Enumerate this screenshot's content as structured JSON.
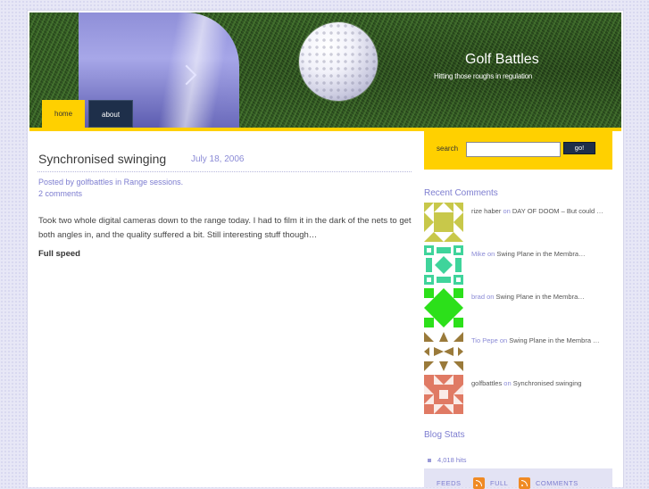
{
  "site": {
    "title": "Golf Battles",
    "tagline": "Hitting those roughs in regulation"
  },
  "nav": {
    "tabs": [
      {
        "label": "home",
        "active": true
      },
      {
        "label": "about",
        "active": false
      }
    ]
  },
  "post": {
    "title": "Synchronised swinging",
    "date": "July 18, 2006",
    "meta_prefix": "Posted by",
    "author": "golfbattles",
    "meta_in": "in",
    "category": "Range sessions.",
    "comments_link": "2 comments",
    "body": "Took two whole digital cameras down to the range today. I had to film it in the dark of the nets to get both angles in, and the quality suffered a bit. Still interesting stuff though…",
    "subheading": "Full speed"
  },
  "search": {
    "label": "search",
    "value": "",
    "button_label": "go!"
  },
  "recent_comments": {
    "heading": "Recent Comments",
    "items": [
      {
        "author": "rize haber",
        "on": "on",
        "target": "DAY OF DOOM – But could …",
        "avatar_color": "#c8c84a"
      },
      {
        "author": "Mike",
        "on": "on",
        "target": "Swing Plane in the Membra…",
        "avatar_color": "#3fd49b"
      },
      {
        "author": "brad",
        "on": "on",
        "target": "Swing Plane in the Membra…",
        "avatar_color": "#2ce01a"
      },
      {
        "author": "Tio Pepe",
        "on": "on",
        "target": "Swing Plane in the Membra …",
        "avatar_color": "#9a7a3a"
      },
      {
        "author": "golfbattles",
        "on": "on",
        "target": "Synchronised swinging",
        "avatar_color": "#e07a64"
      }
    ]
  },
  "blog_stats": {
    "heading": "Blog Stats",
    "hits": "4,018 hits"
  },
  "feeds": {
    "label": "FEEDS",
    "full": "FULL",
    "comments": "COMMENTS"
  },
  "colors": {
    "accent": "#ffd000",
    "link": "#7d7dd0",
    "nav_dark": "#1e2f4a"
  }
}
